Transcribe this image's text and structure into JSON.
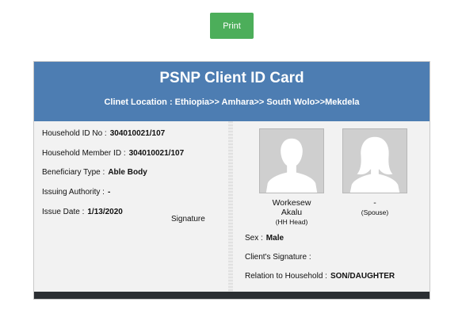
{
  "print_button": {
    "label": "Print"
  },
  "card": {
    "title": "PSNP Client ID Card",
    "location": "Clinet Location : Ethiopia>> Amhara>> South Wolo>>Mekdela",
    "household_id": {
      "label": "Household ID No :",
      "value": "304010021/107"
    },
    "household_member_id": {
      "label": "Household Member ID :",
      "value": "304010021/107"
    },
    "beneficiary_type": {
      "label": "Beneficiary Type :",
      "value": "Able Body"
    },
    "issuing_authority": {
      "label": "Issuing Authority :",
      "value": "-"
    },
    "issue_date": {
      "label": "Issue Date :",
      "value": "1/13/2020"
    },
    "signature_label": "Signature",
    "head": {
      "name_line1": "Workesew",
      "name_line2": "Akalu",
      "role": "(HH Head)",
      "icon": "male-avatar-icon"
    },
    "spouse": {
      "name": "-",
      "role": "(Spouse)",
      "icon": "female-avatar-icon"
    },
    "sex": {
      "label": "Sex :",
      "value": "Male"
    },
    "client_signature": {
      "label": "Client's Signature :"
    },
    "relation": {
      "label": "Relation to Household :",
      "value": "SON/DAUGHTER"
    }
  },
  "colors": {
    "print_button": "#4cae5a",
    "header": "#4d7db2",
    "footer": "#2b2f33"
  }
}
